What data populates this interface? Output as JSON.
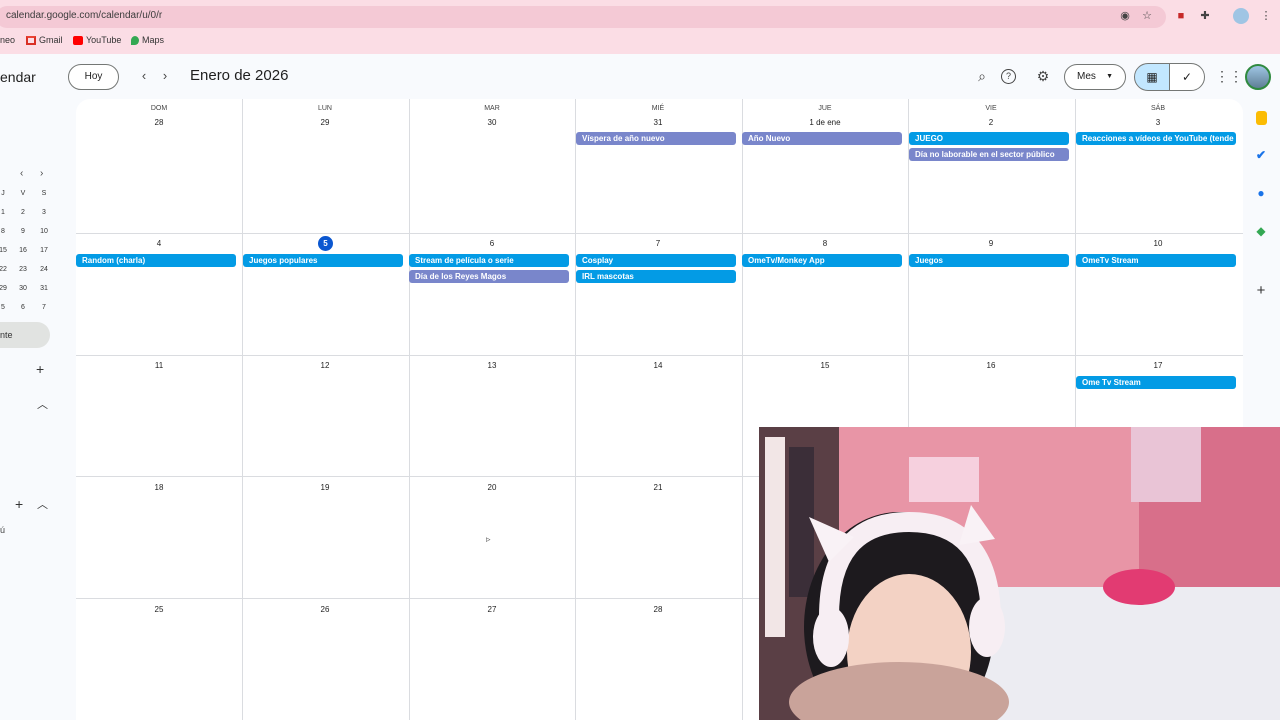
{
  "browser": {
    "url": "calendar.google.com/calendar/u/0/r",
    "bookmarks": [
      "neo",
      "Gmail",
      "YouTube",
      "Maps"
    ]
  },
  "calendar": {
    "brand": "endar",
    "today_button": "Hoy",
    "month_title": "Enero de 2026",
    "view_button": "Mes",
    "weekdays": [
      "DOM",
      "LUN",
      "MAR",
      "MIÉ",
      "JUE",
      "VIE",
      "SÁB"
    ],
    "weeks": [
      [
        "28",
        "29",
        "30",
        "31",
        "1 de ene",
        "2",
        "3"
      ],
      [
        "4",
        "5",
        "6",
        "7",
        "8",
        "9",
        "10"
      ],
      [
        "11",
        "12",
        "13",
        "14",
        "15",
        "16",
        "17"
      ],
      [
        "18",
        "19",
        "20",
        "21",
        "",
        "",
        ""
      ],
      [
        "25",
        "26",
        "27",
        "28",
        "",
        "",
        ""
      ]
    ],
    "events": {
      "w1_mie": "Víspera de año nuevo",
      "w1_jue": "Año Nuevo",
      "w1_vie_1": "JUEGO",
      "w1_vie_2": "Día no laborable en el sector público",
      "w1_sab": "Reacciones a vídeos de YouTube (tende",
      "w2_dom": "Random (charla)",
      "w2_lun": "Juegos populares",
      "w2_mar_1": "Stream de película o serie",
      "w2_mar_2": "Día de los Reyes Magos",
      "w2_mie_1": "Cosplay",
      "w2_mie_2": "IRL mascotas",
      "w2_jue": "OmeTv/Monkey App",
      "w2_vie": "Juegos",
      "w2_sab": "OmeTv Stream",
      "w3_sab": "Ome Tv Stream"
    }
  },
  "mini_calendar": {
    "header": [
      "J",
      "V",
      "S"
    ],
    "rows": [
      [
        "1",
        "2",
        "3"
      ],
      [
        "8",
        "9",
        "10"
      ],
      [
        "15",
        "16",
        "17"
      ],
      [
        "22",
        "23",
        "24"
      ],
      [
        "29",
        "30",
        "31"
      ],
      [
        "5",
        "6",
        "7"
      ]
    ]
  },
  "sidebar": {
    "pill": "nte",
    "tiny": "ú"
  },
  "colors": {
    "event_blue": "#039be5",
    "event_purple": "#7986cb",
    "today": "#0b57d0",
    "chrome": "#fbdde5"
  }
}
